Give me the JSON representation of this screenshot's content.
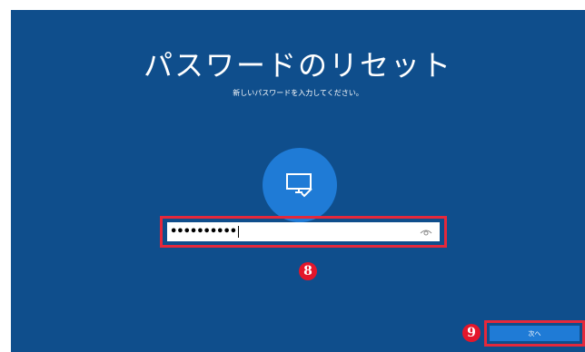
{
  "page": {
    "title": "パスワードのリセット",
    "subtitle": "新しいパスワードを入力してください。"
  },
  "avatar": {
    "icon": "monitor-check-icon"
  },
  "password_field": {
    "value": "••••••••••",
    "reveal_icon": "eye-icon"
  },
  "steps": {
    "step8": "8",
    "step9": "9"
  },
  "next_button": {
    "label": "次へ"
  },
  "colors": {
    "background": "#0f4e8c",
    "accent": "#1f7bd6",
    "highlight": "#e5283b"
  }
}
